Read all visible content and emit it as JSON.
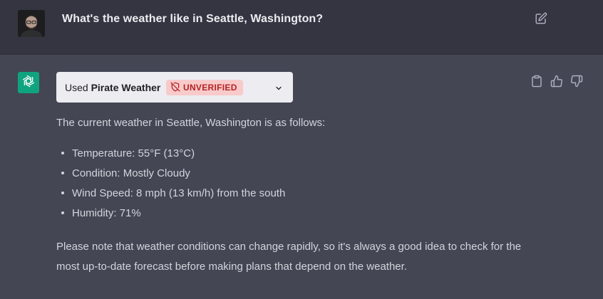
{
  "user_message": {
    "text": "What's the weather like in Seattle, Washington?"
  },
  "plugin": {
    "used_label": "Used",
    "name": "Pirate Weather",
    "badge": "UNVERIFIED"
  },
  "response": {
    "intro": "The current weather in Seattle, Washington is as follows:",
    "items": [
      "Temperature: 55°F (13°C)",
      "Condition: Mostly Cloudy",
      "Wind Speed: 8 mph (13 km/h) from the south",
      "Humidity: 71%"
    ],
    "note": "Please note that weather conditions can change rapidly, so it's always a good idea to check for the most up-to-date forecast before making plans that depend on the weather."
  },
  "icons": {
    "edit": "edit-icon",
    "copy": "clipboard-icon",
    "like": "thumbs-up-icon",
    "dislike": "thumbs-down-icon",
    "unverified": "shield-off-icon",
    "expand": "chevron-down-icon",
    "assistant": "openai-logo-icon"
  },
  "colors": {
    "user_bg": "#343541",
    "assistant_bg": "#444654",
    "assistant_avatar": "#10a37f",
    "badge_bg": "#f8caca",
    "badge_text": "#b42323"
  }
}
